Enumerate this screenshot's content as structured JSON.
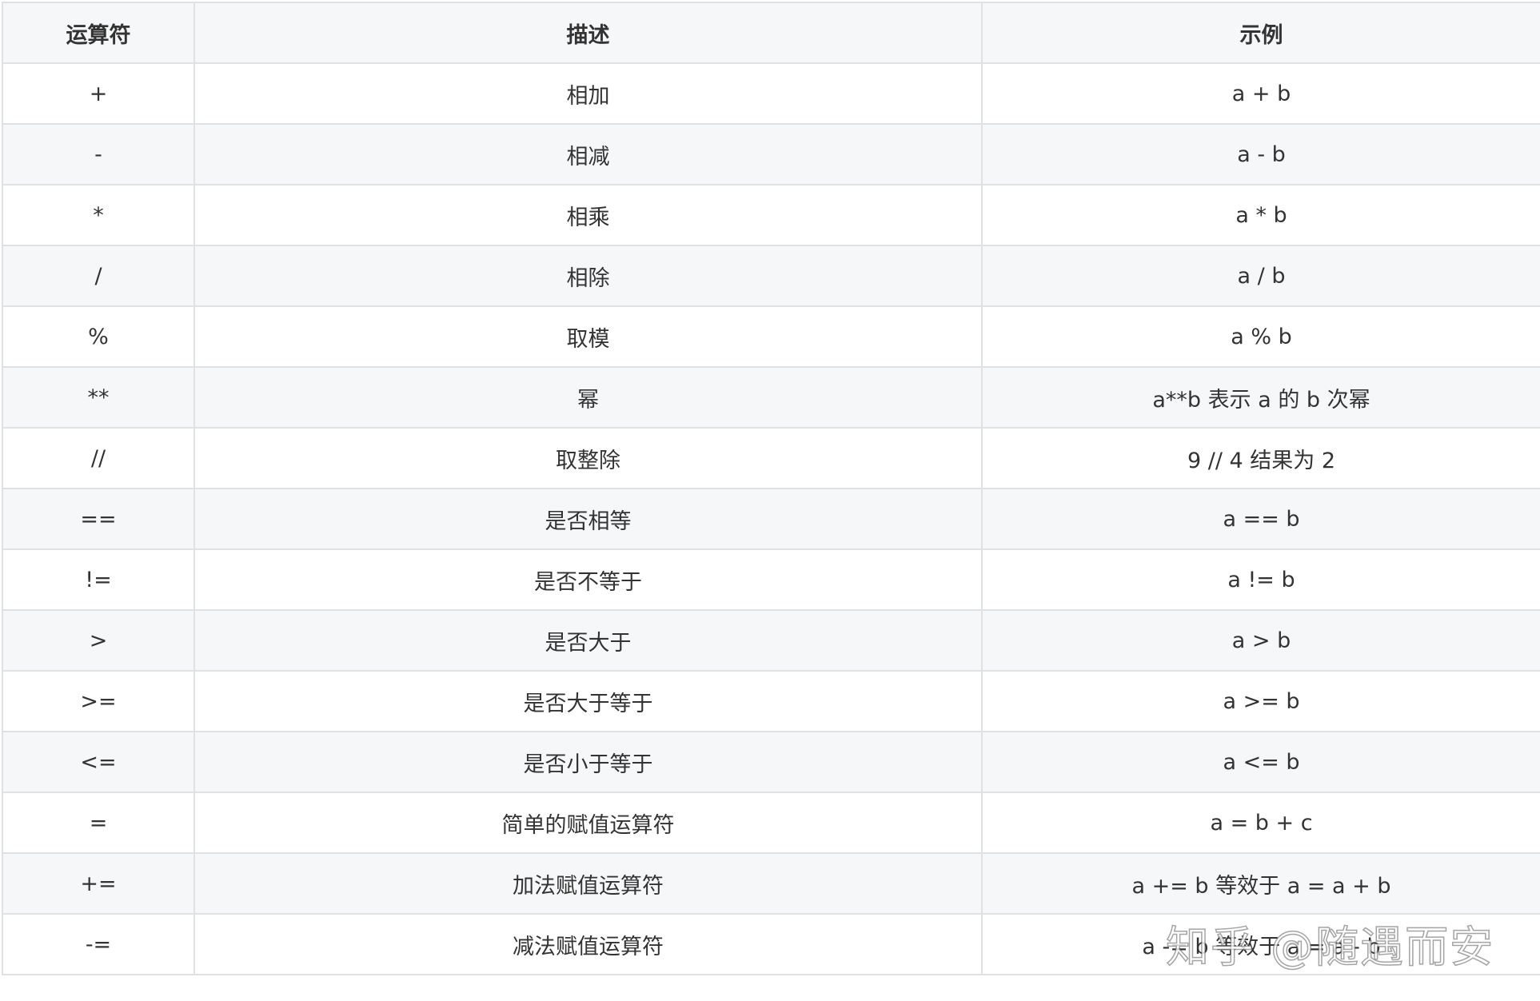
{
  "table": {
    "headers": [
      "运算符",
      "描述",
      "示例"
    ],
    "rows": [
      {
        "op": "+",
        "desc": "相加",
        "example": "a + b"
      },
      {
        "op": "-",
        "desc": "相减",
        "example": "a - b"
      },
      {
        "op": "*",
        "desc": "相乘",
        "example": "a * b"
      },
      {
        "op": "/",
        "desc": "相除",
        "example": "a / b"
      },
      {
        "op": "%",
        "desc": "取模",
        "example": "a % b"
      },
      {
        "op": "**",
        "desc": "幂",
        "example": "a**b 表示 a 的 b 次幂"
      },
      {
        "op": "//",
        "desc": "取整除",
        "example": "9 // 4 结果为 2"
      },
      {
        "op": "==",
        "desc": "是否相等",
        "example": "a == b"
      },
      {
        "op": "!=",
        "desc": "是否不等于",
        "example": "a != b"
      },
      {
        "op": ">",
        "desc": "是否大于",
        "example": "a > b"
      },
      {
        "op": ">=",
        "desc": "是否大于等于",
        "example": "a >= b"
      },
      {
        "op": "<=",
        "desc": "是否小于等于",
        "example": "a <= b"
      },
      {
        "op": "=",
        "desc": "简单的赋值运算符",
        "example": "a = b + c"
      },
      {
        "op": "+=",
        "desc": "加法赋值运算符",
        "example": "a += b 等效于 a = a + b"
      },
      {
        "op": "-=",
        "desc": "减法赋值运算符",
        "example": "a -= b 等效于 a = a - b"
      }
    ]
  },
  "watermark": {
    "text": "知乎 @随遇而安"
  }
}
